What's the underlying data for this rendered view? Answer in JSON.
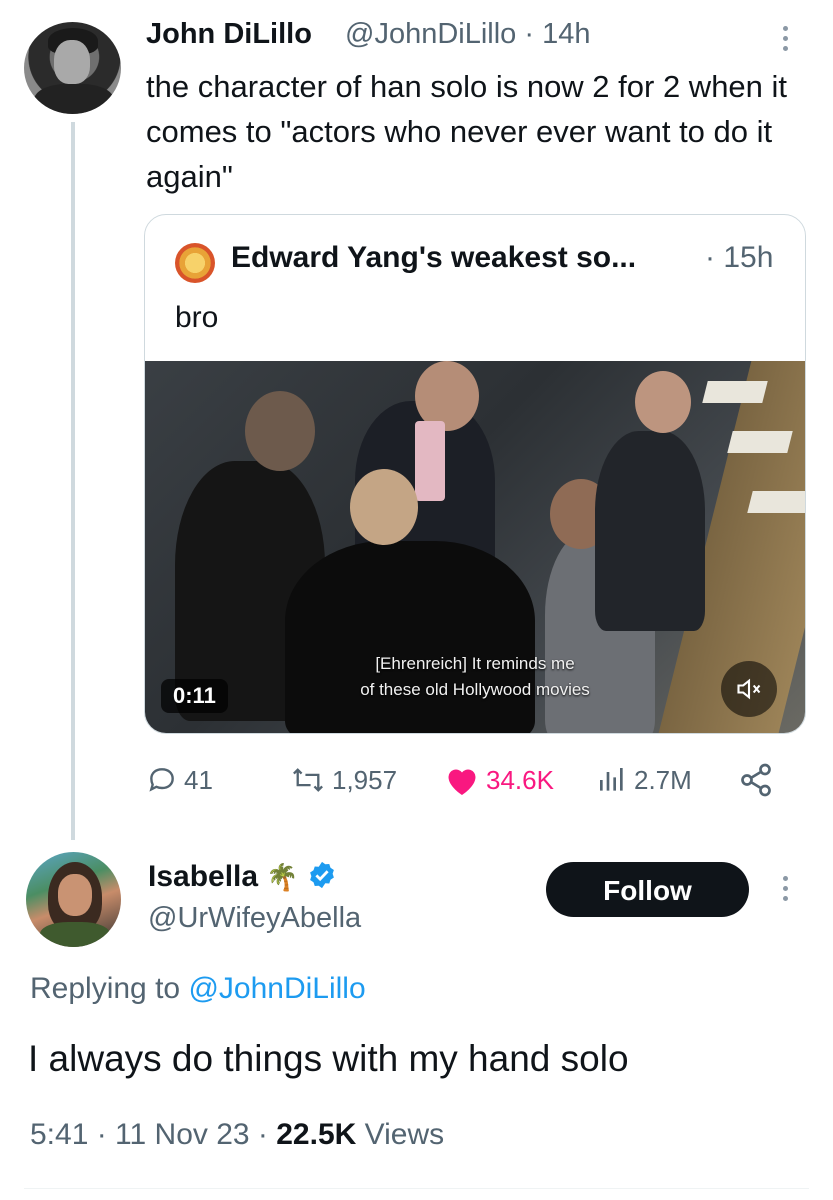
{
  "parent_tweet": {
    "author_name": "John DiLillo",
    "handle_time": "@JohnDiLillo · 14h",
    "text": "the character of han solo is now 2 for 2 when it comes to \"actors who never ever want to do it again\"",
    "quote": {
      "author_name": "Edward Yang's weakest so...",
      "time": "· 15h",
      "text": "bro",
      "video": {
        "duration": "0:11",
        "subtitle_line1": "[Ehrenreich] It reminds me",
        "subtitle_line2": "of these old Hollywood movies",
        "mute_icon": "muted-speaker-icon"
      }
    },
    "actions": {
      "replies": "41",
      "reposts": "1,957",
      "likes": "34.6K",
      "views": "2.7M"
    },
    "like_color": "#f91880"
  },
  "reply_tweet": {
    "author_name": "Isabella",
    "emoji": "🌴",
    "handle": "@UrWifeyAbella",
    "follow_label": "Follow",
    "replying_prefix": "Replying to",
    "replying_handle": "@JohnDiLillo",
    "text": "I always do things with my hand solo",
    "time": "5:41 · 11 Nov 23 ·",
    "views_count": "22.5K",
    "views_label": "Views",
    "verified_color": "#1d9bf0"
  }
}
